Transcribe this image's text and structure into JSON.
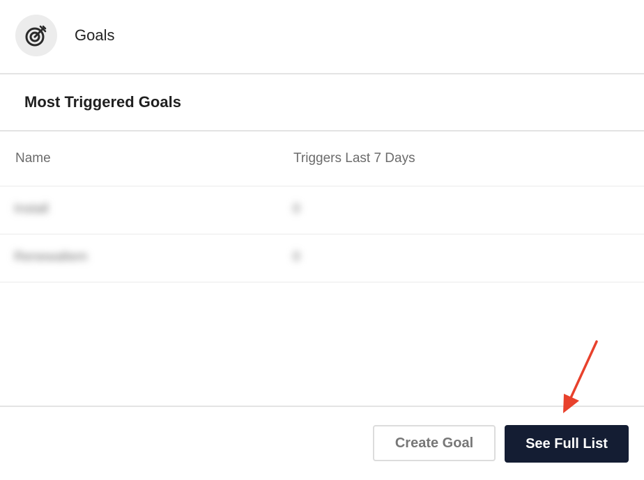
{
  "header": {
    "title": "Goals",
    "icon": "target-icon"
  },
  "section": {
    "title": "Most Triggered Goals"
  },
  "table": {
    "columns": [
      "Name",
      "Triggers Last 7 Days"
    ],
    "rows": [
      {
        "name": "Install",
        "triggers": "0"
      },
      {
        "name": "Renewaltem",
        "triggers": "0"
      }
    ]
  },
  "footer": {
    "create_label": "Create Goal",
    "see_full_list_label": "See Full List"
  },
  "colors": {
    "primary_button": "#141d33",
    "annotation_arrow": "#e8412c"
  }
}
